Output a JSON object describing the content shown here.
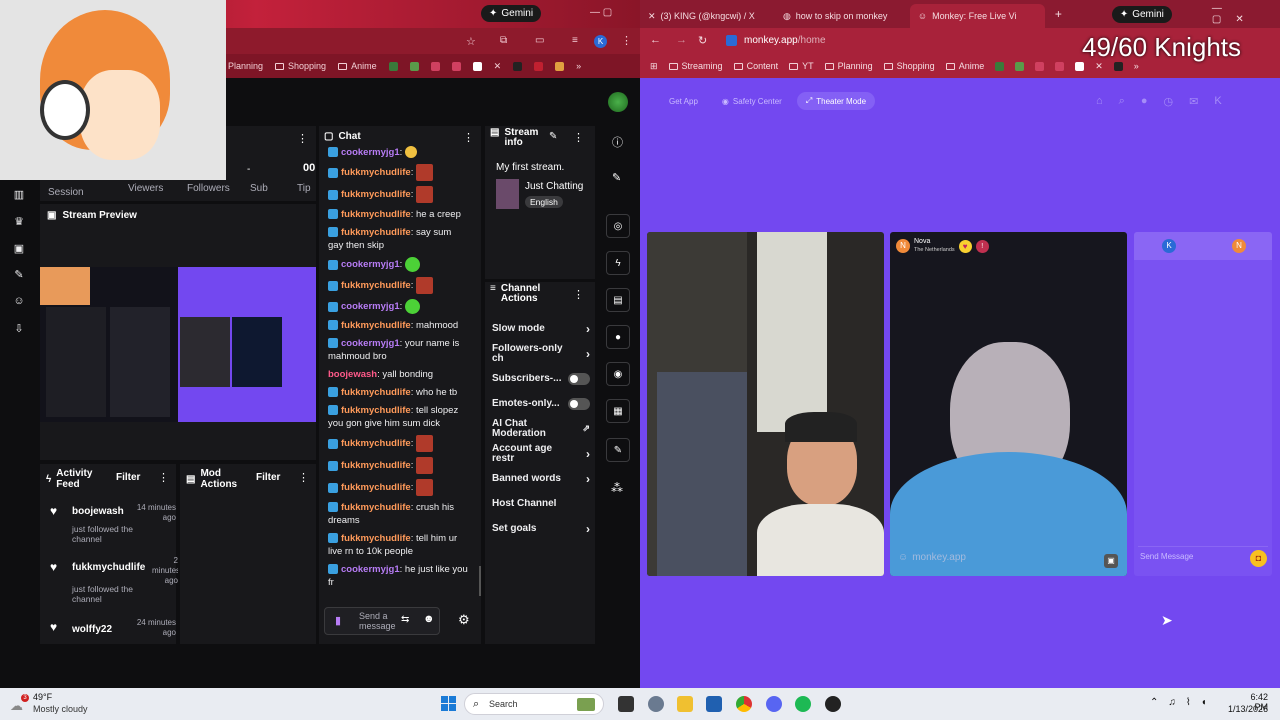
{
  "left_browser": {
    "gemini_label": "Gemini",
    "bookmarks": [
      "Planning",
      "Shopping",
      "Anime"
    ]
  },
  "webcam_overlay_count": "49/60 Knights",
  "dashboard": {
    "stats": {
      "session": "Session",
      "viewers": "Viewers",
      "followers": "Followers",
      "sub": "Sub",
      "tip": "Tip",
      "viewers_value": "-",
      "followers_value": "00"
    },
    "stream_preview": {
      "title": "Stream Preview"
    },
    "chat": {
      "title": "Chat",
      "placeholder": "Send a message",
      "messages": [
        {
          "user": "cookermyjg1",
          "text": "",
          "emote": "emoji",
          "color": "#b77cf5"
        },
        {
          "user": "fukkmychudlife",
          "text": "",
          "emote": "img",
          "color": "#ff9a5a"
        },
        {
          "user": "fukkmychudlife",
          "text": "",
          "emote": "img",
          "color": "#ff9a5a"
        },
        {
          "user": "fukkmychudlife",
          "text": "he a creep",
          "emote": "",
          "color": "#ff9a5a"
        },
        {
          "user": "fukkmychudlife",
          "text": "say sum gay then skip",
          "emote": "",
          "color": "#ff9a5a"
        },
        {
          "user": "cookermyjg1",
          "text": "",
          "emote": "green",
          "color": "#b77cf5"
        },
        {
          "user": "fukkmychudlife",
          "text": "",
          "emote": "img",
          "color": "#ff9a5a"
        },
        {
          "user": "cookermyjg1",
          "text": "",
          "emote": "green",
          "color": "#b77cf5"
        },
        {
          "user": "fukkmychudlife",
          "text": "mahmood",
          "emote": "",
          "color": "#ff9a5a"
        },
        {
          "user": "cookermyjg1",
          "text": "your name is mahmoud bro",
          "emote": "",
          "color": "#b77cf5"
        },
        {
          "user": "boojewash",
          "text": "yall bonding",
          "emote": "",
          "color": "#ff5a8a",
          "nobadge": true
        },
        {
          "user": "fukkmychudlife",
          "text": "who he tb",
          "emote": "",
          "color": "#ff9a5a"
        },
        {
          "user": "fukkmychudlife",
          "text": "tell slopez you gon give him sum dick",
          "emote": "",
          "color": "#ff9a5a"
        },
        {
          "user": "fukkmychudlife",
          "text": "",
          "emote": "img",
          "color": "#ff9a5a"
        },
        {
          "user": "fukkmychudlife",
          "text": "",
          "emote": "img",
          "color": "#ff9a5a"
        },
        {
          "user": "fukkmychudlife",
          "text": "",
          "emote": "img",
          "color": "#ff9a5a"
        },
        {
          "user": "fukkmychudlife",
          "text": "crush his dreams",
          "emote": "",
          "color": "#ff9a5a"
        },
        {
          "user": "fukkmychudlife",
          "text": "tell him ur live rn to 10k people",
          "emote": "",
          "color": "#ff9a5a"
        },
        {
          "user": "cookermyjg1",
          "text": "he just like you fr",
          "emote": "",
          "color": "#b77cf5"
        }
      ]
    },
    "stream_info": {
      "title": "Stream info",
      "stream_title": "My first stream.",
      "category": "Just Chatting",
      "language": "English"
    },
    "channel_actions": {
      "title": "Channel Actions",
      "items": [
        {
          "label": "Slow mode",
          "kind": "chevron"
        },
        {
          "label": "Followers-only ch",
          "kind": "chevron"
        },
        {
          "label": "Subscribers-...",
          "kind": "toggle"
        },
        {
          "label": "Emotes-only...",
          "kind": "toggle"
        },
        {
          "label": "AI Chat Moderation",
          "kind": "link"
        },
        {
          "label": "Account age restr",
          "kind": "chevron"
        },
        {
          "label": "Banned words",
          "kind": "chevron"
        },
        {
          "label": "Host Channel",
          "kind": "none"
        },
        {
          "label": "Set goals",
          "kind": "chevron"
        }
      ]
    },
    "activity_feed": {
      "title": "Activity Feed",
      "filter": "Filter",
      "items": [
        {
          "user": "boojewash",
          "time": "14 minutes ago",
          "desc": "just followed the channel"
        },
        {
          "user": "fukkmychudlife",
          "time": "2 minutes ago",
          "desc": "just followed the channel"
        },
        {
          "user": "wolffy22",
          "time": "24 minutes ago",
          "desc": ""
        }
      ]
    },
    "mod_actions": {
      "title": "Mod Actions",
      "filter": "Filter"
    }
  },
  "right_browser": {
    "tabs": [
      {
        "label": "(3) KING (@kngcwi) / X"
      },
      {
        "label": "how to skip on monkey"
      },
      {
        "label": "Monkey: Free Live Vi"
      }
    ],
    "gemini_label": "Gemini",
    "url_host": "monkey.app",
    "url_path": "/home",
    "bookmarks": [
      "Streaming",
      "Content",
      "YT",
      "Planning",
      "Shopping",
      "Anime"
    ]
  },
  "monkey": {
    "nav": {
      "get_app": "Get App",
      "safety": "Safety Center",
      "theater": "Theater Mode"
    },
    "peer": {
      "name": "Nova",
      "country": "The Netherlands",
      "avatar_letter": "N"
    },
    "watermark": "monkey.app",
    "side_avatars": [
      "K",
      "N"
    ],
    "chat_placeholder": "Send Message"
  },
  "taskbar": {
    "weather_temp": "49°F",
    "weather_desc": "Mostly cloudy",
    "search": "Search",
    "time": "6:42 PM",
    "date": "1/13/2026"
  }
}
